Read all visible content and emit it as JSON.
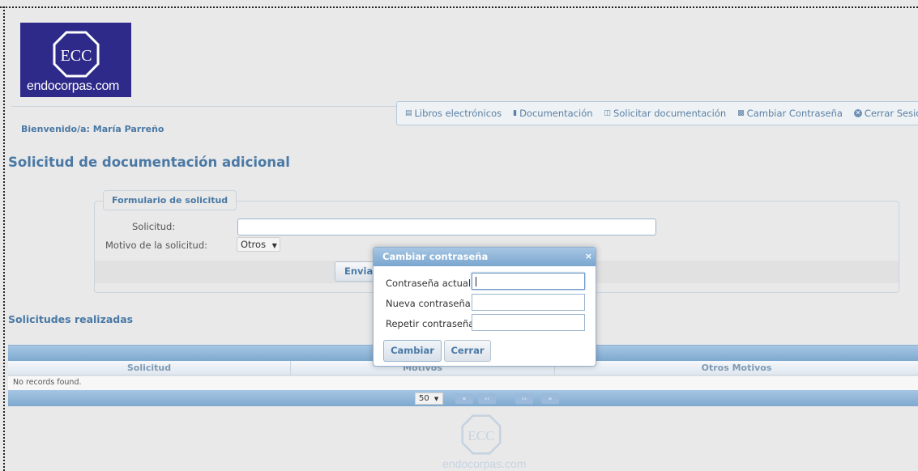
{
  "logo": {
    "text": "endocorpas.com",
    "emblem_text": "ECC",
    "bg_color": "#2e2a8a"
  },
  "welcome": "Bienvenido/a: María Parreño",
  "nav": [
    {
      "icon": "book-icon",
      "label": "Libros electrónicos"
    },
    {
      "icon": "document-icon",
      "label": "Documentación"
    },
    {
      "icon": "request-document-icon",
      "label": "Solicitar documentación"
    },
    {
      "icon": "lock-icon",
      "label": "Cambiar Contraseña"
    },
    {
      "icon": "close-circle-icon",
      "label": "Cerrar Sesión"
    }
  ],
  "page_title": "Solicitud de documentación adicional",
  "form": {
    "legend": "Formulario de solicitud",
    "solicitud_label": "Solicitud:",
    "solicitud_value": "",
    "motivo_label": "Motivo de la solicitud:",
    "motivo_value": "Otros",
    "submit": "Enviar"
  },
  "requests": {
    "title": "Solicitudes realizadas",
    "columns": [
      "Solicitud",
      "Motivos",
      "Otros Motivos"
    ],
    "empty": "No records found.",
    "page_size": "50"
  },
  "watermark": {
    "emblem_text": "ECC",
    "text": "endocorpas.com"
  },
  "modal": {
    "title": "Cambiar contraseña",
    "close": "×",
    "current_label": "Contraseña actual:",
    "new_label": "Nueva contraseña",
    "repeat_label": "Repetir contraseña",
    "change_button": "Cambiar",
    "close_button": "Cerrar"
  },
  "colors": {
    "accent": "#4a79a5",
    "bar": "#7ea9cf"
  }
}
